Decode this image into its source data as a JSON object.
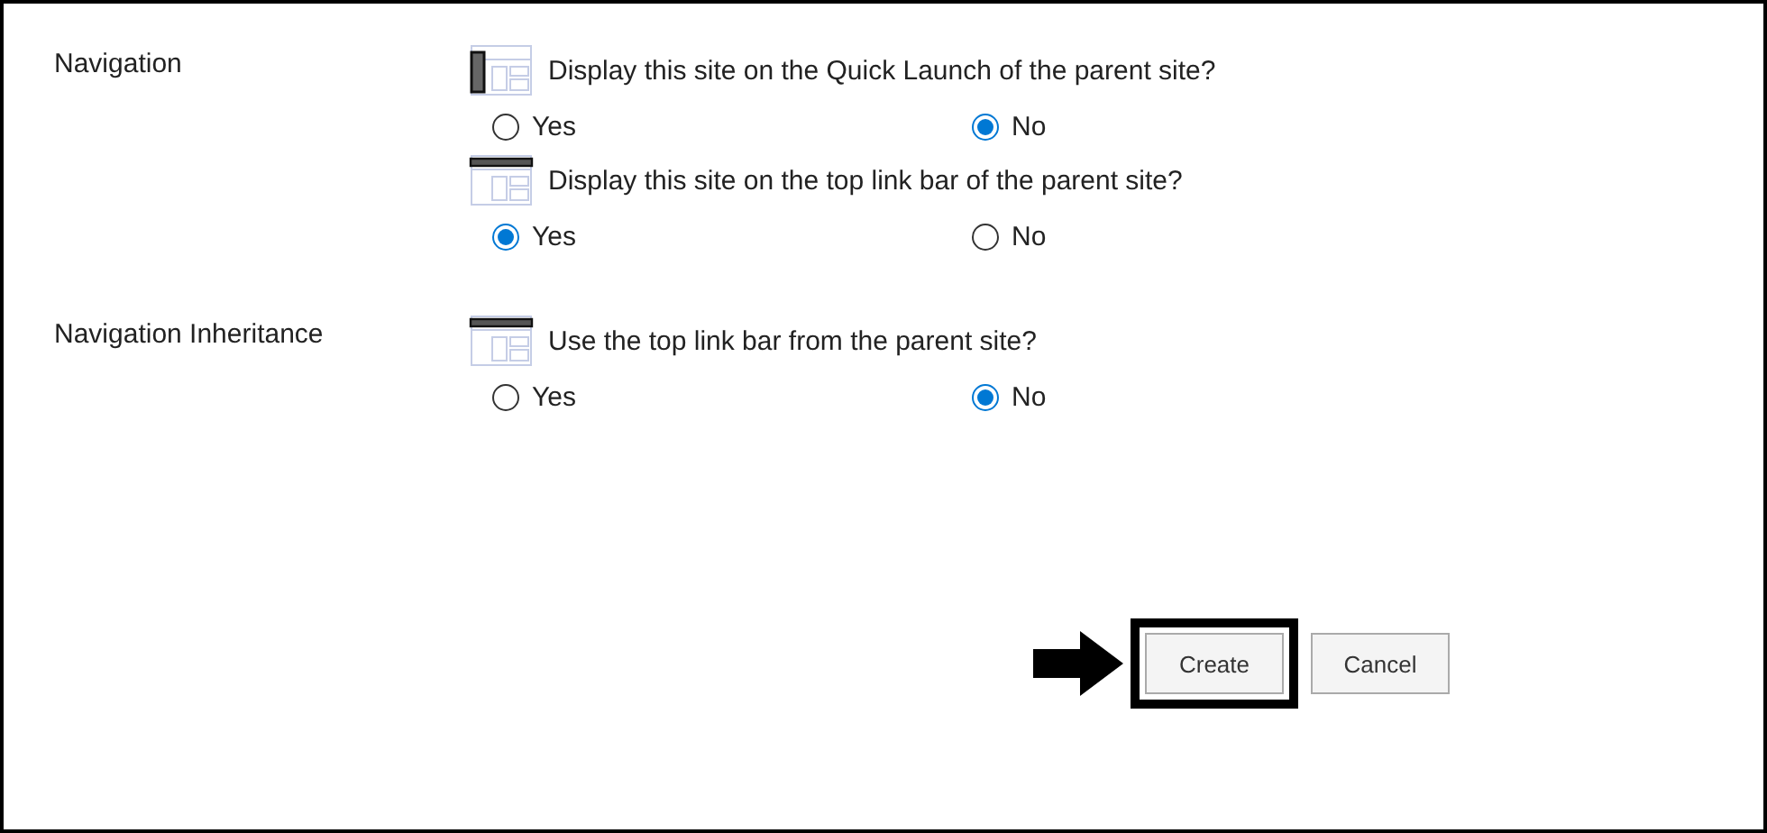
{
  "sections": [
    {
      "label": "Navigation",
      "questions": [
        {
          "kind": "quick-launch",
          "text": "Display this site on the Quick Launch of the parent site?",
          "options": [
            {
              "label": "Yes",
              "selected": false
            },
            {
              "label": "No",
              "selected": true
            }
          ]
        },
        {
          "kind": "top-link-bar",
          "text": "Display this site on the top link bar of the parent site?",
          "options": [
            {
              "label": "Yes",
              "selected": true
            },
            {
              "label": "No",
              "selected": false
            }
          ]
        }
      ]
    },
    {
      "label": "Navigation Inheritance",
      "questions": [
        {
          "kind": "top-link-bar",
          "text": "Use the top link bar from the parent site?",
          "options": [
            {
              "label": "Yes",
              "selected": false
            },
            {
              "label": "No",
              "selected": true
            }
          ]
        }
      ]
    }
  ],
  "buttons": [
    {
      "label": "Create",
      "highlighted": true
    },
    {
      "label": "Cancel",
      "highlighted": false
    }
  ]
}
